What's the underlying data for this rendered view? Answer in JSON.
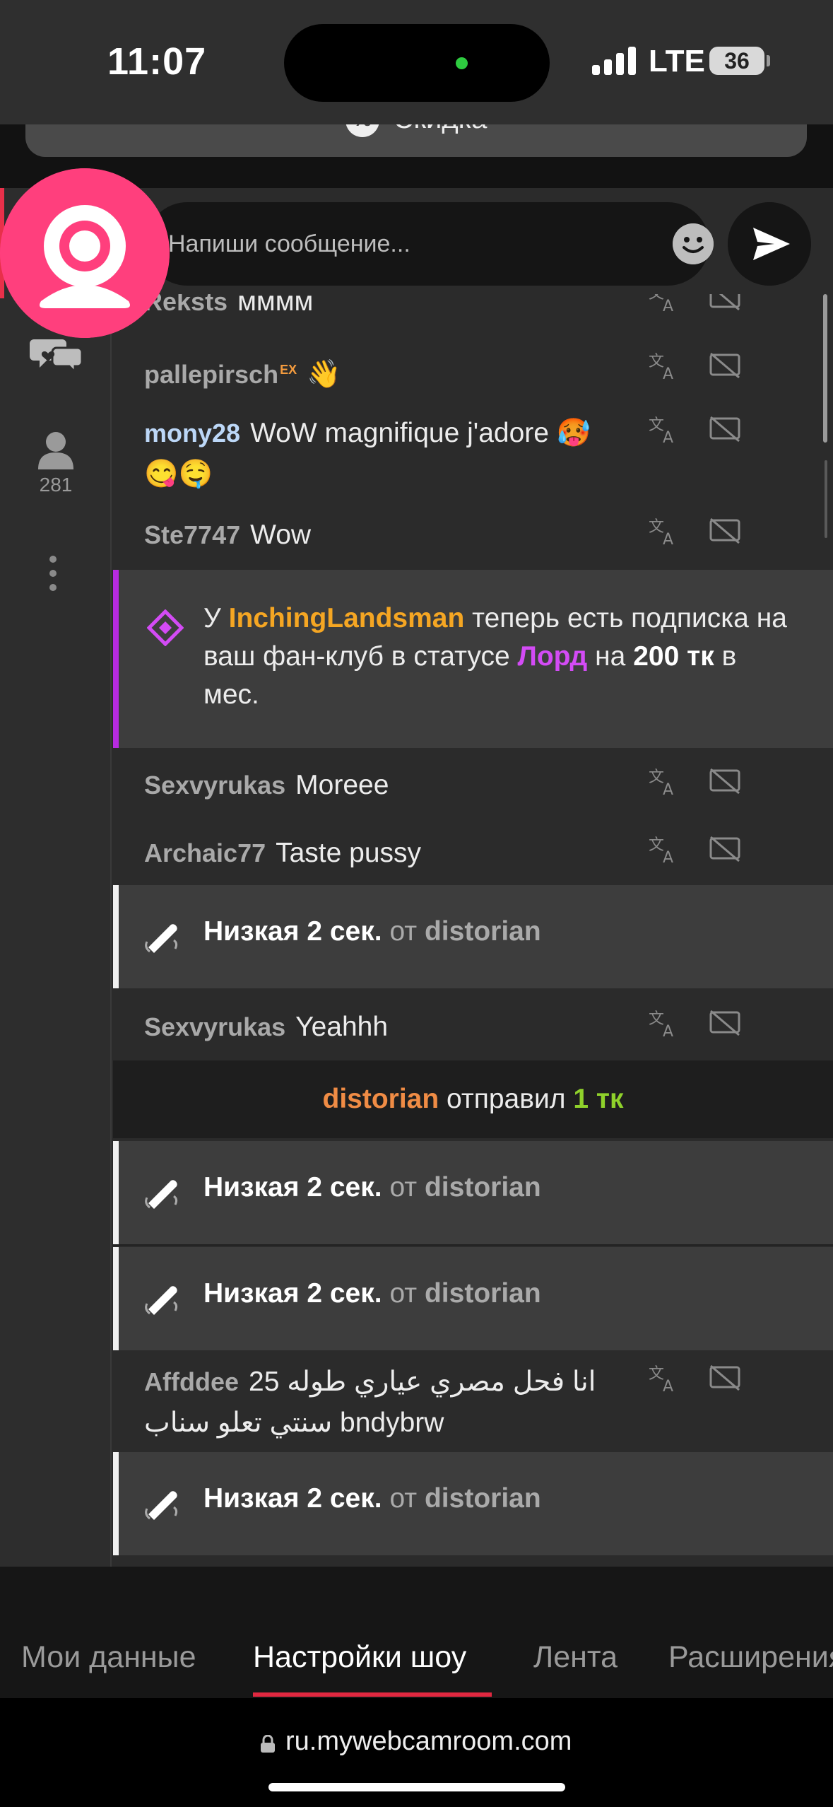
{
  "status_bar": {
    "time": "11:07",
    "network": "LTE",
    "battery": "36"
  },
  "discount": {
    "label": "Скидка"
  },
  "rail": {
    "viewers_count": "281"
  },
  "input": {
    "placeholder": "Напиши сообщение..."
  },
  "chat": {
    "msg1": {
      "user": "Reksts",
      "text": "мммм"
    },
    "msg2": {
      "user": "pallepirsch",
      "badge": "EX",
      "text": "👋"
    },
    "msg3": {
      "user": "mony28",
      "text": "WoW magnifique j'adore 🥵😋🤤"
    },
    "msg4": {
      "user": "Ste7747",
      "text": "Wow"
    },
    "fanclub": {
      "prefix": "У",
      "user": "InchingLandsman",
      "mid": "теперь есть подписка на ваш фан-клуб в статусе",
      "status": "Лорд",
      "on": "на",
      "amount": "200 тк",
      "suffix": "в мес."
    },
    "msg5": {
      "user": "Sexvyrukas",
      "text": "Moreee"
    },
    "msg6": {
      "user": "Archaic77",
      "text": "Taste pussy"
    },
    "vibe1": {
      "level": "Низкая 2 сек.",
      "from": "от",
      "user": "distorian"
    },
    "msg7": {
      "user": "Sexvyrukas",
      "text": "Yeahhh"
    },
    "tip": {
      "user": "distorian",
      "action": "отправил",
      "amount": "1 тк"
    },
    "vibe2": {
      "level": "Низкая 2 сек.",
      "from": "от",
      "user": "distorian"
    },
    "vibe3": {
      "level": "Низкая 2 сек.",
      "from": "от",
      "user": "distorian"
    },
    "msg8": {
      "user": "Affddee",
      "text": "انا فحل مصري عياري طوله 25 سنتي تعلو سناب bndybrw"
    },
    "vibe4": {
      "level": "Низкая 2 сек.",
      "from": "от",
      "user": "distorian"
    }
  },
  "tabs": [
    "Мои данные",
    "Настройки шоу",
    "Лента",
    "Расширения"
  ],
  "active_tab": "Настройки шоу",
  "url": "ru.mywebcamroom.com",
  "colors": {
    "accent_pink": "#ff3f7d",
    "username_orange": "#f5a623",
    "fanclub_purple": "#d34bf5",
    "tip_green": "#8fd12b",
    "tab_active_underline": "#e02840"
  }
}
